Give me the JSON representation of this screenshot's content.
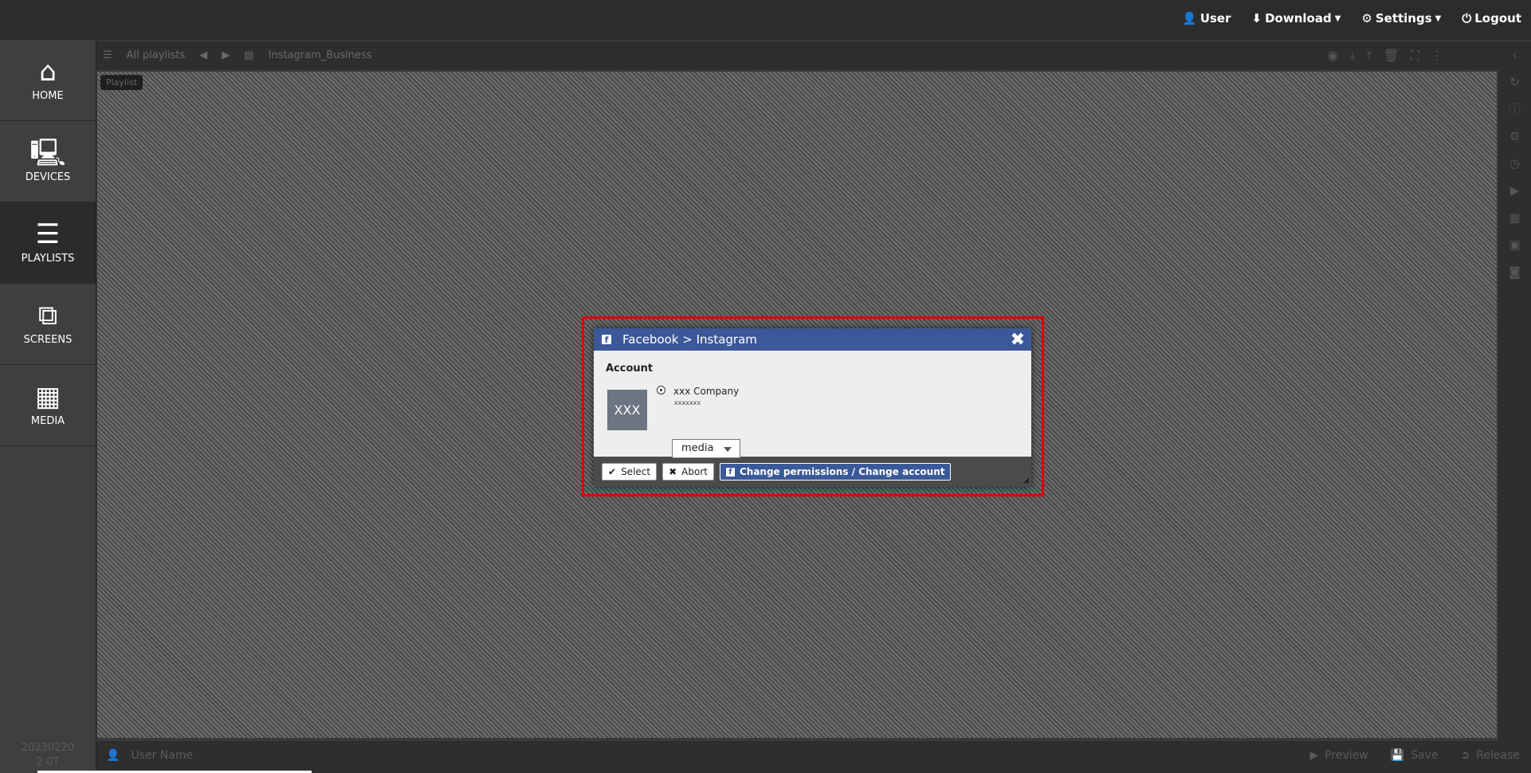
{
  "topnav": {
    "user": "User",
    "download": "Download",
    "settings": "Settings",
    "logout": "Logout"
  },
  "sidebar": {
    "items": [
      {
        "label": "HOME",
        "icon": "home-icon"
      },
      {
        "label": "DEVICES",
        "icon": "devices-icon"
      },
      {
        "label": "PLAYLISTS",
        "icon": "playlists-icon"
      },
      {
        "label": "SCREENS",
        "icon": "screens-icon"
      },
      {
        "label": "MEDIA",
        "icon": "media-icon"
      }
    ],
    "active": "PLAYLISTS",
    "version_line1": "20230220",
    "version_line2": "2.0T"
  },
  "toolbar": {
    "all_playlists": "All playlists",
    "playlist_name": "Instagram_Business"
  },
  "canvas": {
    "tag": "Playlist"
  },
  "bottombar": {
    "username": "User Name",
    "preview": "Preview",
    "save": "Save",
    "release": "Release"
  },
  "dialog": {
    "title": "Facebook > Instagram",
    "account_label": "Account",
    "avatar_text": "XXX",
    "company": "xxx Company",
    "company_sub": "xxxxxxx",
    "select_value": "media",
    "select_label": "Select",
    "abort_label": "Abort",
    "change_label": "Change permissions / Change account"
  },
  "colors": {
    "facebook_blue": "#3b5998",
    "highlight_red": "#e00000"
  }
}
